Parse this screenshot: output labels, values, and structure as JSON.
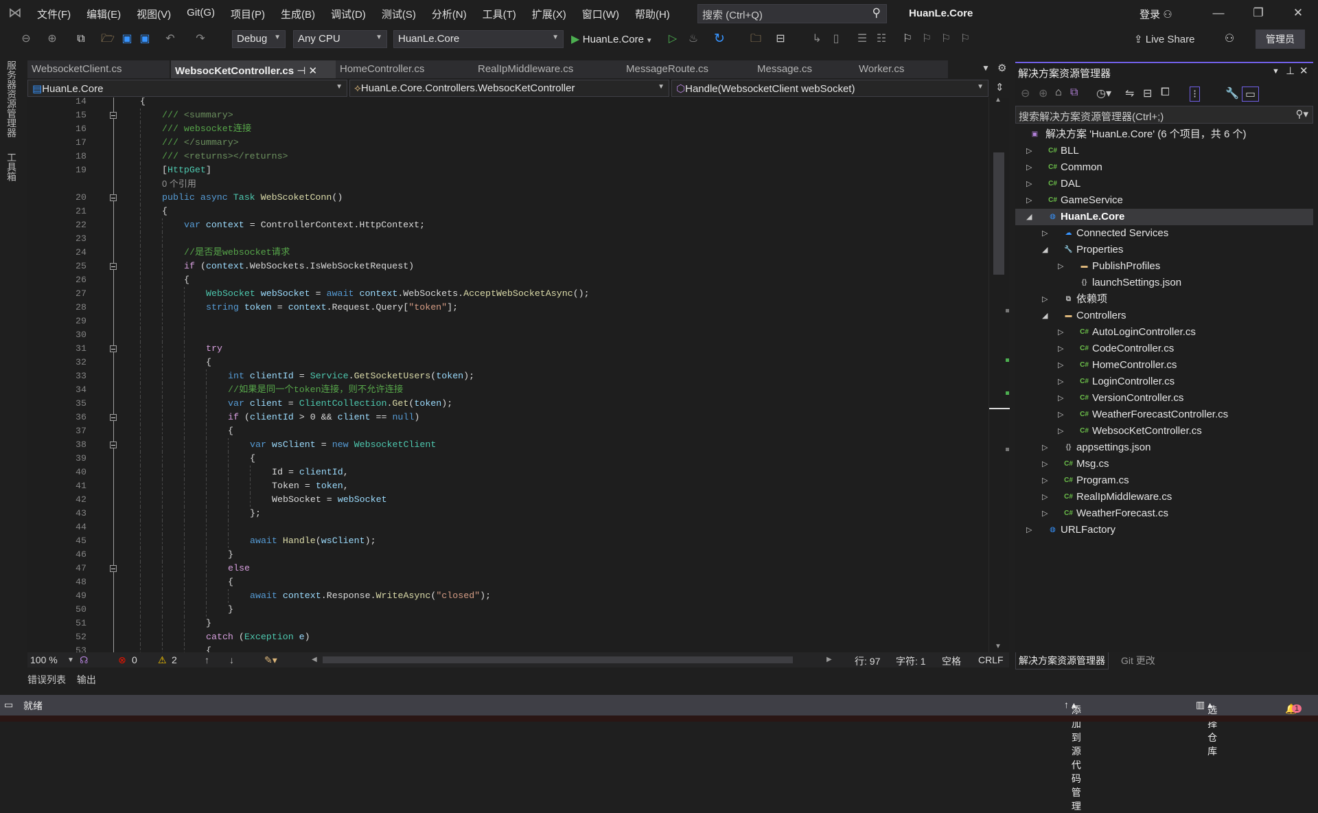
{
  "menubar": {
    "items": [
      "文件(F)",
      "编辑(E)",
      "视图(V)",
      "Git(G)",
      "项目(P)",
      "生成(B)",
      "调试(D)",
      "测试(S)",
      "分析(N)",
      "工具(T)",
      "扩展(X)",
      "窗口(W)",
      "帮助(H)"
    ],
    "search_placeholder": "搜索 (Ctrl+Q)",
    "title": "HuanLe.Core",
    "login": "登录"
  },
  "toolbar": {
    "config": "Debug",
    "platform": "Any CPU",
    "startup": "HuanLe.Core",
    "run_label": "HuanLe.Core",
    "live_share": "Live Share",
    "admin": "管理员"
  },
  "sidestrip": {
    "server_explorer": "服务器资源管理器",
    "toolbox": "工具箱"
  },
  "tabs": [
    {
      "label": "WebsocketClient.cs"
    },
    {
      "label": "WebsocKetController.cs",
      "active": true
    },
    {
      "label": "HomeController.cs"
    },
    {
      "label": "RealIpMiddleware.cs"
    },
    {
      "label": "MessageRoute.cs"
    },
    {
      "label": "Message.cs"
    },
    {
      "label": "Worker.cs"
    }
  ],
  "navbar": {
    "project": "HuanLe.Core",
    "class": "HuanLe.Core.Controllers.WebsocKetController",
    "member": "Handle(WebsocketClient webSocket)"
  },
  "code": [
    {
      "n": "14",
      "i": 4,
      "t": [
        [
          "{",
          "tx"
        ]
      ]
    },
    {
      "n": "15",
      "i": 8,
      "f": 1,
      "t": [
        [
          "/// ",
          "doc"
        ],
        [
          "<summary>",
          "docx"
        ]
      ]
    },
    {
      "n": "16",
      "i": 8,
      "t": [
        [
          "/// ",
          "doc"
        ],
        [
          "websocket连接",
          "doc"
        ]
      ]
    },
    {
      "n": "17",
      "i": 8,
      "t": [
        [
          "/// ",
          "doc"
        ],
        [
          "</summary>",
          "docx"
        ]
      ]
    },
    {
      "n": "18",
      "i": 8,
      "t": [
        [
          "/// ",
          "doc"
        ],
        [
          "<returns></returns>",
          "docx"
        ]
      ]
    },
    {
      "n": "19",
      "i": 8,
      "t": [
        [
          "[",
          "tx"
        ],
        [
          "HttpGet",
          "ty"
        ],
        [
          "]",
          "tx"
        ]
      ]
    },
    {
      "n": "",
      "i": 8,
      "t": [
        [
          "0 个引用",
          "lens"
        ]
      ]
    },
    {
      "n": "20",
      "i": 8,
      "f": 1,
      "t": [
        [
          "public async ",
          "kw"
        ],
        [
          "Task ",
          "ty"
        ],
        [
          "WebScoketConn",
          "fn"
        ],
        [
          "()",
          "tx"
        ]
      ]
    },
    {
      "n": "21",
      "i": 8,
      "t": [
        [
          "{",
          "tx"
        ]
      ]
    },
    {
      "n": "22",
      "i": 12,
      "t": [
        [
          "var ",
          "kw"
        ],
        [
          "context",
          "var"
        ],
        [
          " = ControllerContext.HttpContext;",
          "tx"
        ]
      ]
    },
    {
      "n": "23",
      "i": 12,
      "t": []
    },
    {
      "n": "24",
      "i": 12,
      "t": [
        [
          "//是否是websocket请求",
          "cm"
        ]
      ]
    },
    {
      "n": "25",
      "i": 12,
      "f": 1,
      "t": [
        [
          "if ",
          "ctl"
        ],
        [
          "(",
          "tx"
        ],
        [
          "context",
          "var"
        ],
        [
          ".WebSockets.IsWebSocketRequest)",
          "tx"
        ]
      ]
    },
    {
      "n": "26",
      "i": 12,
      "t": [
        [
          "{",
          "tx"
        ]
      ]
    },
    {
      "n": "27",
      "i": 16,
      "t": [
        [
          "WebSocket ",
          "ty"
        ],
        [
          "webSocket",
          "var"
        ],
        [
          " = ",
          "tx"
        ],
        [
          "await ",
          "kw"
        ],
        [
          "context",
          "var"
        ],
        [
          ".WebSockets.",
          "tx"
        ],
        [
          "AcceptWebSocketAsync",
          "fn"
        ],
        [
          "();",
          "tx"
        ]
      ]
    },
    {
      "n": "28",
      "i": 16,
      "t": [
        [
          "string ",
          "kw"
        ],
        [
          "token",
          "var"
        ],
        [
          " = ",
          "tx"
        ],
        [
          "context",
          "var"
        ],
        [
          ".Request.Query[",
          "tx"
        ],
        [
          "\"token\"",
          "str"
        ],
        [
          "];",
          "tx"
        ]
      ]
    },
    {
      "n": "29",
      "i": 16,
      "t": []
    },
    {
      "n": "30",
      "i": 16,
      "t": []
    },
    {
      "n": "31",
      "i": 16,
      "f": 1,
      "t": [
        [
          "try",
          "ctl"
        ]
      ]
    },
    {
      "n": "32",
      "i": 16,
      "t": [
        [
          "{",
          "tx"
        ]
      ]
    },
    {
      "n": "33",
      "i": 20,
      "t": [
        [
          "int ",
          "kw"
        ],
        [
          "clientId",
          "var"
        ],
        [
          " = ",
          "tx"
        ],
        [
          "Service",
          "ty"
        ],
        [
          ".",
          "tx"
        ],
        [
          "GetSocketUsers",
          "fn"
        ],
        [
          "(",
          "tx"
        ],
        [
          "token",
          "var"
        ],
        [
          ");",
          "tx"
        ]
      ]
    },
    {
      "n": "34",
      "i": 20,
      "t": [
        [
          "//如果是同一个token连接，则不允许连接",
          "cm"
        ]
      ]
    },
    {
      "n": "35",
      "i": 20,
      "t": [
        [
          "var ",
          "kw"
        ],
        [
          "client",
          "var"
        ],
        [
          " = ",
          "tx"
        ],
        [
          "ClientCollection",
          "ty"
        ],
        [
          ".",
          "tx"
        ],
        [
          "Get",
          "fn"
        ],
        [
          "(",
          "tx"
        ],
        [
          "token",
          "var"
        ],
        [
          ");",
          "tx"
        ]
      ]
    },
    {
      "n": "36",
      "i": 20,
      "f": 1,
      "t": [
        [
          "if ",
          "ctl"
        ],
        [
          "(",
          "tx"
        ],
        [
          "clientId",
          "var"
        ],
        [
          " > 0 && ",
          "tx"
        ],
        [
          "client",
          "var"
        ],
        [
          " == ",
          "tx"
        ],
        [
          "null",
          "kw"
        ],
        [
          ")",
          "tx"
        ]
      ]
    },
    {
      "n": "37",
      "i": 20,
      "t": [
        [
          "{",
          "tx"
        ]
      ]
    },
    {
      "n": "38",
      "i": 24,
      "f": 1,
      "t": [
        [
          "var ",
          "kw"
        ],
        [
          "wsClient",
          "var"
        ],
        [
          " = ",
          "tx"
        ],
        [
          "new ",
          "kw"
        ],
        [
          "WebsocketClient",
          "ty"
        ]
      ]
    },
    {
      "n": "39",
      "i": 24,
      "t": [
        [
          "{",
          "tx"
        ]
      ]
    },
    {
      "n": "40",
      "i": 28,
      "t": [
        [
          "Id = ",
          "tx"
        ],
        [
          "clientId",
          "var"
        ],
        [
          ",",
          "tx"
        ]
      ]
    },
    {
      "n": "41",
      "i": 28,
      "t": [
        [
          "Token = ",
          "tx"
        ],
        [
          "token",
          "var"
        ],
        [
          ",",
          "tx"
        ]
      ]
    },
    {
      "n": "42",
      "i": 28,
      "t": [
        [
          "WebSocket = ",
          "tx"
        ],
        [
          "webSocket",
          "var"
        ]
      ]
    },
    {
      "n": "43",
      "i": 24,
      "t": [
        [
          "};",
          "tx"
        ]
      ]
    },
    {
      "n": "44",
      "i": 24,
      "t": []
    },
    {
      "n": "45",
      "i": 24,
      "t": [
        [
          "await ",
          "kw"
        ],
        [
          "Handle",
          "fn"
        ],
        [
          "(",
          "tx"
        ],
        [
          "wsClient",
          "var"
        ],
        [
          ");",
          "tx"
        ]
      ]
    },
    {
      "n": "46",
      "i": 20,
      "t": [
        [
          "}",
          "tx"
        ]
      ]
    },
    {
      "n": "47",
      "i": 20,
      "f": 1,
      "t": [
        [
          "else",
          "ctl"
        ]
      ]
    },
    {
      "n": "48",
      "i": 20,
      "t": [
        [
          "{",
          "tx"
        ]
      ]
    },
    {
      "n": "49",
      "i": 24,
      "t": [
        [
          "await ",
          "kw"
        ],
        [
          "context",
          "var"
        ],
        [
          ".Response.",
          "tx"
        ],
        [
          "WriteAsync",
          "fn"
        ],
        [
          "(",
          "tx"
        ],
        [
          "\"closed\"",
          "str"
        ],
        [
          ");",
          "tx"
        ]
      ]
    },
    {
      "n": "50",
      "i": 20,
      "t": [
        [
          "}",
          "tx"
        ]
      ]
    },
    {
      "n": "51",
      "i": 16,
      "t": [
        [
          "}",
          "tx"
        ]
      ]
    },
    {
      "n": "52",
      "i": 16,
      "t": [
        [
          "catch ",
          "ctl"
        ],
        [
          "(",
          "tx"
        ],
        [
          "Exception ",
          "ty"
        ],
        [
          "e",
          "var"
        ],
        [
          ")",
          "tx"
        ]
      ]
    },
    {
      "n": "53",
      "i": 16,
      "t": [
        [
          "{",
          "tx"
        ]
      ]
    }
  ],
  "editor_status": {
    "zoom": "100 %",
    "errors": "0",
    "warnings": "2",
    "line": "行: 97",
    "char": "字符: 1",
    "spaces": "空格",
    "eol": "CRLF"
  },
  "bottom_tabs": {
    "errors": "错误列表",
    "output": "输出"
  },
  "statusbar": {
    "ready": "就绪",
    "add_source": "添加到源代码管理",
    "select_repo": "选择仓库",
    "notifications": "1"
  },
  "solution_explorer": {
    "title": "解决方案资源管理器",
    "search_placeholder": "搜索解决方案资源管理器(Ctrl+;)",
    "items": [
      {
        "label": "解决方案 'HuanLe.Core' (6 个项目，共 6 个)",
        "level": -1,
        "exp": "",
        "icon": "solution"
      },
      {
        "label": "BLL",
        "level": 0,
        "exp": "right",
        "icon": "cs-project"
      },
      {
        "label": "Common",
        "level": 0,
        "exp": "right",
        "icon": "cs-project"
      },
      {
        "label": "DAL",
        "level": 0,
        "exp": "right",
        "icon": "cs-project"
      },
      {
        "label": "GameService",
        "level": 0,
        "exp": "right",
        "icon": "cs-project"
      },
      {
        "label": "HuanLe.Core",
        "level": 0,
        "exp": "down",
        "icon": "web-project",
        "selected": true
      },
      {
        "label": "Connected Services",
        "level": 1,
        "exp": "right",
        "icon": "connected-services"
      },
      {
        "label": "Properties",
        "level": 1,
        "exp": "down",
        "icon": "properties"
      },
      {
        "label": "PublishProfiles",
        "level": 2,
        "exp": "right",
        "icon": "folder"
      },
      {
        "label": "launchSettings.json",
        "level": 2,
        "exp": "",
        "icon": "json"
      },
      {
        "label": "依赖项",
        "level": 1,
        "exp": "right",
        "icon": "dependencies"
      },
      {
        "label": "Controllers",
        "level": 1,
        "exp": "down",
        "icon": "folder"
      },
      {
        "label": "AutoLoginController.cs",
        "level": 2,
        "exp": "right",
        "icon": "cs-file"
      },
      {
        "label": "CodeController.cs",
        "level": 2,
        "exp": "right",
        "icon": "cs-file"
      },
      {
        "label": "HomeController.cs",
        "level": 2,
        "exp": "right",
        "icon": "cs-file"
      },
      {
        "label": "LoginController.cs",
        "level": 2,
        "exp": "right",
        "icon": "cs-file"
      },
      {
        "label": "VersionController.cs",
        "level": 2,
        "exp": "right",
        "icon": "cs-file"
      },
      {
        "label": "WeatherForecastController.cs",
        "level": 2,
        "exp": "right",
        "icon": "cs-file"
      },
      {
        "label": "WebsocKetController.cs",
        "level": 2,
        "exp": "right",
        "icon": "cs-file"
      },
      {
        "label": "appsettings.json",
        "level": 1,
        "exp": "right",
        "icon": "json"
      },
      {
        "label": "Msg.cs",
        "level": 1,
        "exp": "right",
        "icon": "cs-file"
      },
      {
        "label": "Program.cs",
        "level": 1,
        "exp": "right",
        "icon": "cs-file"
      },
      {
        "label": "RealIpMiddleware.cs",
        "level": 1,
        "exp": "right",
        "icon": "cs-file"
      },
      {
        "label": "WeatherForecast.cs",
        "level": 1,
        "exp": "right",
        "icon": "cs-file"
      },
      {
        "label": "URLFactory",
        "level": 0,
        "exp": "right",
        "icon": "web-project"
      }
    ],
    "bottom_tabs": [
      "解决方案资源管理器",
      "Git 更改"
    ]
  },
  "colors": {
    "accent": "#7160e8",
    "run": "#4caf50",
    "error": "#e51400",
    "warning": "#ffcc00"
  }
}
